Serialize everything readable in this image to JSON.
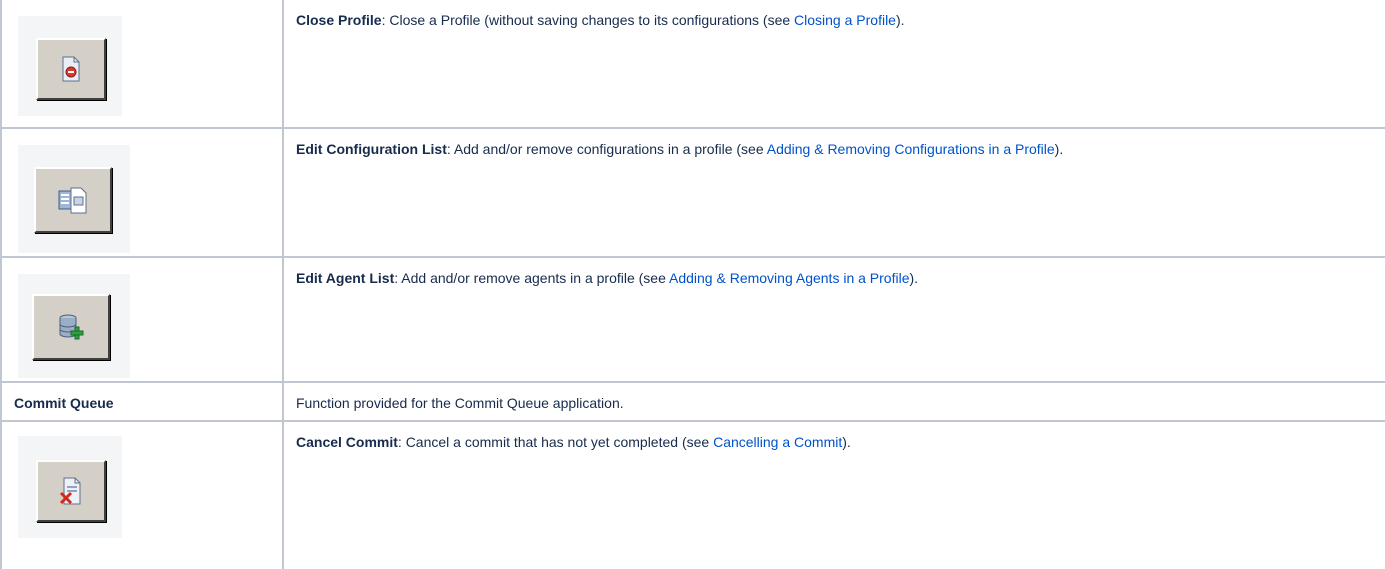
{
  "rows": [
    {
      "icon": "close-profile-icon",
      "title": "Close Profile",
      "text_before": ": Close a Profile (without saving changes to its configurations (see ",
      "link": "Closing a Profile",
      "text_after": ")."
    },
    {
      "icon": "edit-configuration-list-icon",
      "title": "Edit Configuration List",
      "text_before": ": Add and/or remove configurations in a profile (see ",
      "link": "Adding & Removing Configurations in a Profile",
      "text_after": ")."
    },
    {
      "icon": "edit-agent-list-icon",
      "title": "Edit Agent List",
      "text_before": ": Add and/or remove agents in a profile (see ",
      "link": "Adding & Removing Agents in a Profile",
      "text_after": ")."
    },
    {
      "section_label": "Commit Queue",
      "section_text": "Function provided for the Commit Queue application."
    },
    {
      "icon": "cancel-commit-icon",
      "title": "Cancel Commit",
      "text_before": ": Cancel a commit that has not yet completed (see ",
      "link": "Cancelling a Commit",
      "text_after": ")."
    }
  ],
  "colors": {
    "link": "#0052cc",
    "text": "#172b4d",
    "border": "#c1c7d0",
    "icon_background": "#f4f5f7",
    "button_face": "#d4d0c8"
  }
}
